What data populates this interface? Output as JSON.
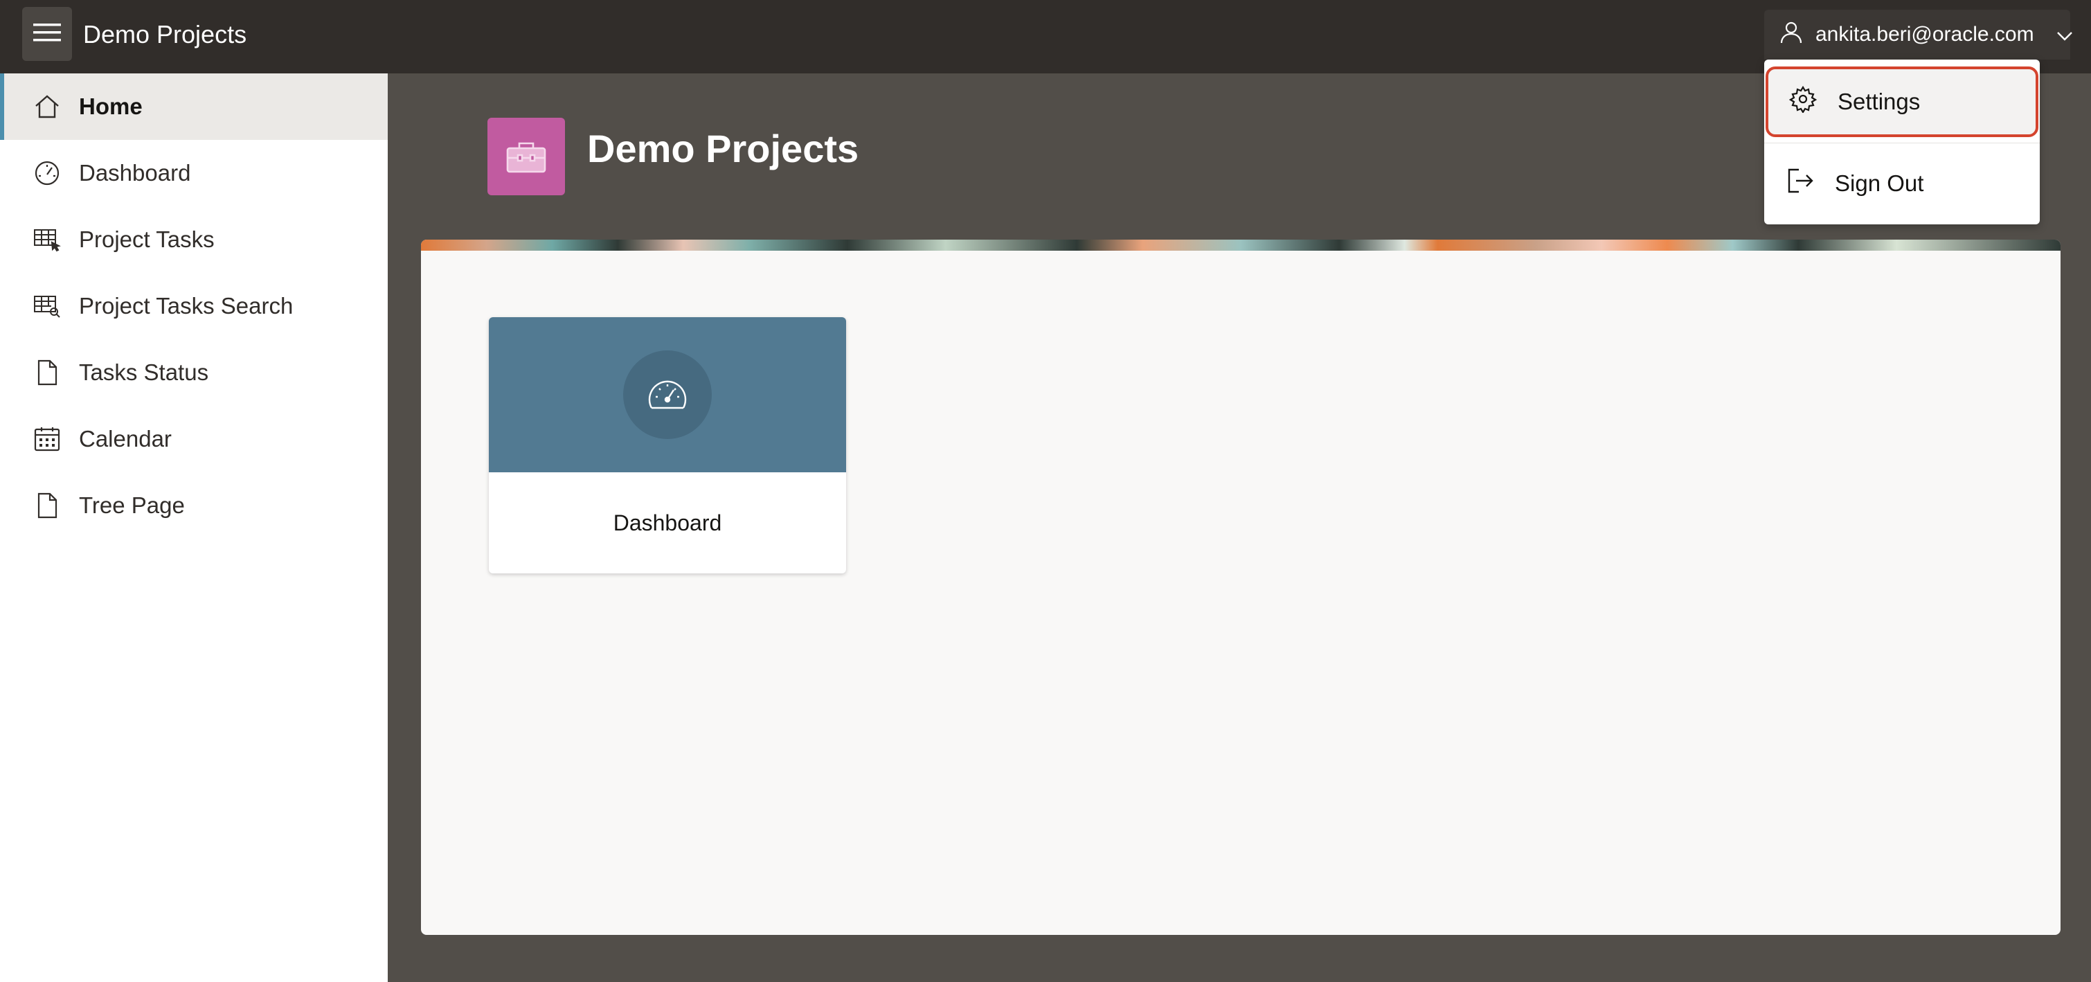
{
  "header": {
    "app_title": "Demo Projects",
    "user_email": "ankita.beri@oracle.com"
  },
  "sidebar": {
    "items": [
      {
        "label": "Home",
        "icon": "home-icon",
        "active": true
      },
      {
        "label": "Dashboard",
        "icon": "dashboard-icon"
      },
      {
        "label": "Project Tasks",
        "icon": "table-pointer-icon"
      },
      {
        "label": "Project Tasks Search",
        "icon": "table-search-icon"
      },
      {
        "label": "Tasks Status",
        "icon": "file-icon"
      },
      {
        "label": "Calendar",
        "icon": "calendar-icon"
      },
      {
        "label": "Tree Page",
        "icon": "file-icon"
      }
    ]
  },
  "hero": {
    "title": "Demo Projects",
    "icon": "briefcase-icon",
    "icon_color": "#c15ba0"
  },
  "cards": [
    {
      "label": "Dashboard",
      "icon": "dashboard-icon",
      "color": "#527a92"
    }
  ],
  "user_dropdown": {
    "items": [
      {
        "label": "Settings",
        "icon": "gear-icon"
      },
      {
        "label": "Sign Out",
        "icon": "sign-out-icon"
      }
    ]
  },
  "colors": {
    "header_bg": "#312d2a",
    "body_bg": "#524e49",
    "accent": "#4c8fad",
    "focus_ring": "#d4442e"
  }
}
